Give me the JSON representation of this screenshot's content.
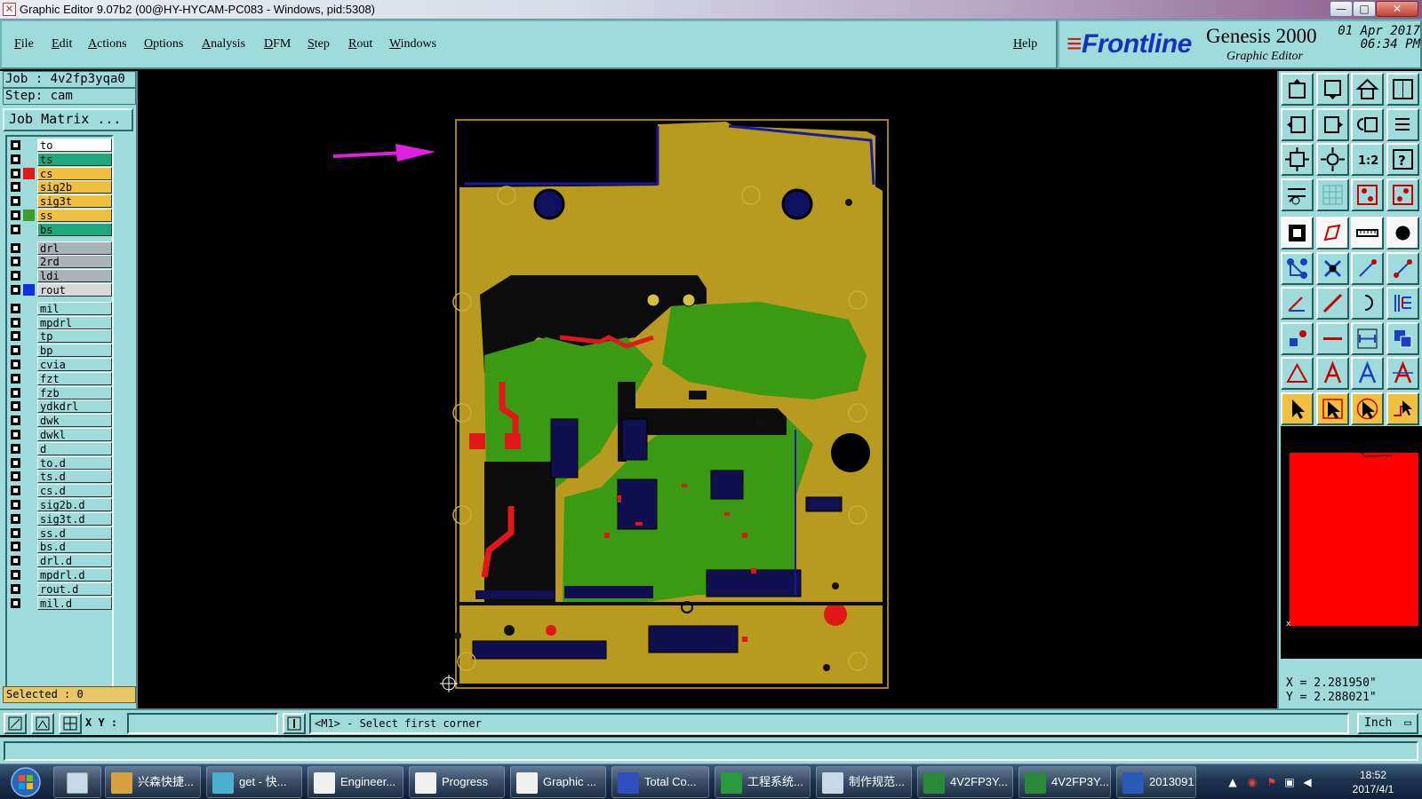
{
  "window": {
    "title": "Graphic Editor 9.07b2 (00@HY-HYCAM-PC083 - Windows, pid:5308)",
    "controls": {
      "minimize": "—",
      "maximize": "□",
      "close": "✕"
    }
  },
  "menu": {
    "items": [
      {
        "label": "File",
        "u": "F",
        "rest": "ile"
      },
      {
        "label": "Edit",
        "u": "E",
        "rest": "dit"
      },
      {
        "label": "Actions",
        "u": "A",
        "rest": "ctions"
      },
      {
        "label": "Options",
        "u": "O",
        "rest": "ptions"
      },
      {
        "label": "Analysis",
        "u": "A",
        "rest": "nalysis"
      },
      {
        "label": "DFM",
        "u": "D",
        "rest": "FM"
      },
      {
        "label": "Step",
        "u": "S",
        "rest": "tep"
      },
      {
        "label": "Rout",
        "u": "R",
        "rest": "out"
      },
      {
        "label": "Windows",
        "u": "W",
        "rest": "indows"
      }
    ],
    "help": {
      "label": "Help",
      "u": "H",
      "rest": "elp"
    }
  },
  "brand": {
    "logo": "Frontline",
    "product": "Genesis 2000",
    "subtitle": "Graphic Editor",
    "date": "01 Apr 2017",
    "time": "06:34 PM"
  },
  "left": {
    "job": "Job : 4v2fp3yqa0",
    "step": "Step: cam",
    "job_matrix": "Job Matrix ...",
    "selected": "Selected : 0",
    "layers": [
      {
        "name": "to",
        "bg": "#ffffff",
        "swatch": ""
      },
      {
        "name": "ts",
        "bg": "#1fa87a",
        "swatch": ""
      },
      {
        "name": "cs",
        "bg": "#f0c040",
        "swatch": "#e01818",
        "active": true
      },
      {
        "name": "sig2b",
        "bg": "#f0c040",
        "swatch": ""
      },
      {
        "name": "sig3t",
        "bg": "#f0c040",
        "swatch": ""
      },
      {
        "name": "ss",
        "bg": "#f0c040",
        "swatch": "#3aa02a"
      },
      {
        "name": "bs",
        "bg": "#1fa87a",
        "swatch": ""
      },
      {
        "name": "drl",
        "bg": "#a9b4b8",
        "swatch": ""
      },
      {
        "name": "2rd",
        "bg": "#a9b4b8",
        "swatch": ""
      },
      {
        "name": "ldi",
        "bg": "#a9b4b8",
        "swatch": ""
      },
      {
        "name": "rout",
        "bg": "#d8d8d8",
        "swatch": "#1030e0"
      },
      {
        "name": "mil",
        "bg": "#9fdbdb",
        "swatch": ""
      },
      {
        "name": "mpdrl",
        "bg": "#9fdbdb",
        "swatch": ""
      },
      {
        "name": "tp",
        "bg": "#9fdbdb",
        "swatch": ""
      },
      {
        "name": "bp",
        "bg": "#9fdbdb",
        "swatch": ""
      },
      {
        "name": "cvia",
        "bg": "#9fdbdb",
        "swatch": ""
      },
      {
        "name": "fzt",
        "bg": "#9fdbdb",
        "swatch": ""
      },
      {
        "name": "fzb",
        "bg": "#9fdbdb",
        "swatch": ""
      },
      {
        "name": "ydkdrl",
        "bg": "#9fdbdb",
        "swatch": ""
      },
      {
        "name": "dwk",
        "bg": "#9fdbdb",
        "swatch": ""
      },
      {
        "name": "dwkl",
        "bg": "#9fdbdb",
        "swatch": ""
      },
      {
        "name": "d",
        "bg": "#9fdbdb",
        "swatch": ""
      },
      {
        "name": "to.d",
        "bg": "#9fdbdb",
        "swatch": ""
      },
      {
        "name": "ts.d",
        "bg": "#9fdbdb",
        "swatch": ""
      },
      {
        "name": "cs.d",
        "bg": "#9fdbdb",
        "swatch": ""
      },
      {
        "name": "sig2b.d",
        "bg": "#9fdbdb",
        "swatch": ""
      },
      {
        "name": "sig3t.d",
        "bg": "#9fdbdb",
        "swatch": ""
      },
      {
        "name": "ss.d",
        "bg": "#9fdbdb",
        "swatch": ""
      },
      {
        "name": "bs.d",
        "bg": "#9fdbdb",
        "swatch": ""
      },
      {
        "name": "drl.d",
        "bg": "#9fdbdb",
        "swatch": ""
      },
      {
        "name": "mpdrl.d",
        "bg": "#9fdbdb",
        "swatch": ""
      },
      {
        "name": "rout.d",
        "bg": "#9fdbdb",
        "swatch": ""
      },
      {
        "name": "mil.d",
        "bg": "#9fdbdb",
        "swatch": ""
      }
    ]
  },
  "right": {
    "tools": [
      {
        "name": "home-top-icon",
        "style": ""
      },
      {
        "name": "home-bottom-icon",
        "style": ""
      },
      {
        "name": "home-icon",
        "style": ""
      },
      {
        "name": "window-icon",
        "style": ""
      },
      {
        "name": "pan-left-icon",
        "style": ""
      },
      {
        "name": "pan-right-icon",
        "style": ""
      },
      {
        "name": "undo-view-icon",
        "style": ""
      },
      {
        "name": "redraw-icon",
        "style": ""
      },
      {
        "name": "zoom-fit-icon",
        "style": ""
      },
      {
        "name": "zoom-center-icon",
        "style": ""
      },
      {
        "name": "ratio-icon",
        "style": ""
      },
      {
        "name": "help-icon",
        "style": ""
      },
      {
        "name": "measure-icon",
        "style": ""
      },
      {
        "name": "grid-icon",
        "style": ""
      },
      {
        "name": "snap-red-icon",
        "style": ""
      },
      {
        "name": "snap-red-alt-icon",
        "style": ""
      },
      {
        "name": "fill-box-icon",
        "style": "white"
      },
      {
        "name": "select-poly-icon",
        "style": "white"
      },
      {
        "name": "ruler-icon",
        "style": "white"
      },
      {
        "name": "pad-icon",
        "style": "white"
      },
      {
        "name": "connect-icon",
        "style": ""
      },
      {
        "name": "cross-icon",
        "style": ""
      },
      {
        "name": "line-node-icon",
        "style": ""
      },
      {
        "name": "line-node-alt-icon",
        "style": ""
      },
      {
        "name": "angle-icon",
        "style": ""
      },
      {
        "name": "diag-line-icon",
        "style": ""
      },
      {
        "name": "arc-icon",
        "style": ""
      },
      {
        "name": "offset-icon",
        "style": ""
      },
      {
        "name": "move-pad-icon",
        "style": ""
      },
      {
        "name": "dash-icon",
        "style": ""
      },
      {
        "name": "dimension-icon",
        "style": ""
      },
      {
        "name": "copy-pad-icon",
        "style": ""
      },
      {
        "name": "triangle-icon",
        "style": ""
      },
      {
        "name": "text-a-icon",
        "style": ""
      },
      {
        "name": "text-a-alt-icon",
        "style": ""
      },
      {
        "name": "text-a-red-icon",
        "style": ""
      },
      {
        "name": "pointer-icon",
        "style": "yellow"
      },
      {
        "name": "pointer-box-icon",
        "style": "yellow"
      },
      {
        "name": "pointer-red-icon",
        "style": "yellow"
      },
      {
        "name": "pointer-route-icon",
        "style": "yellow"
      }
    ],
    "x_coord": "X = 2.281950\"",
    "y_coord": "Y = 2.288021\""
  },
  "status": {
    "xy_label": "X Y :",
    "xy_value": "",
    "prompt": "<M1> - Select first corner",
    "units": "Inch"
  },
  "taskbar": {
    "items": [
      {
        "label": "兴森快捷...",
        "icon": "#d8a040"
      },
      {
        "label": "get - 快...",
        "icon": "#4bb0d0"
      },
      {
        "label": "Engineer...",
        "icon": "#f0f0f0"
      },
      {
        "label": "Progress",
        "icon": "#f0f0f0"
      },
      {
        "label": "Graphic ...",
        "icon": "#f0f0f0"
      },
      {
        "label": "Total Co...",
        "icon": "#3050c0"
      },
      {
        "label": "工程系统...",
        "icon": "#2a9a40"
      },
      {
        "label": "制作规范...",
        "icon": "#c8d8e8"
      },
      {
        "label": "4V2FP3Y...",
        "icon": "#2a8a3a"
      },
      {
        "label": "4V2FP3Y...",
        "icon": "#2a8a3a"
      },
      {
        "label": "2013091...",
        "icon": "#2a5ab8"
      }
    ],
    "clock_time": "18:52",
    "clock_date": "2017/4/1"
  }
}
